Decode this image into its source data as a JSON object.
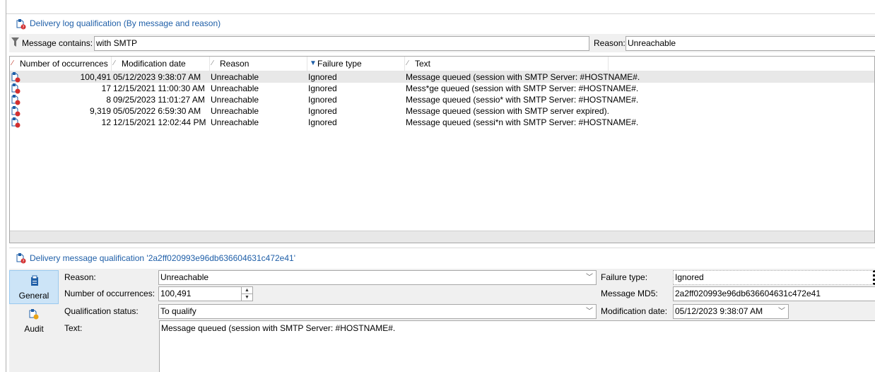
{
  "header": {
    "title": "Delivery log qualification (By message and reason)"
  },
  "filter": {
    "message_label": "Message contains:",
    "message_value": "with SMTP",
    "reason_label": "Reason:",
    "reason_value": "Unreachable"
  },
  "grid": {
    "columns": [
      "Number of occurrences",
      "Modification date",
      "Reason",
      "Failure type",
      "Text"
    ],
    "rows": [
      {
        "count": "100,491",
        "date": "05/12/2023 9:38:07 AM",
        "reason": "Unreachable",
        "failure": "Ignored",
        "text": "Message queued (session with SMTP Server: #HOSTNAME#."
      },
      {
        "count": "17",
        "date": "12/15/2021 11:00:30 AM",
        "reason": "Unreachable",
        "failure": "Ignored",
        "text": "Mess*ge queued (session with SMTP Server: #HOSTNAME#."
      },
      {
        "count": "8",
        "date": "09/25/2023 11:01:27 AM",
        "reason": "Unreachable",
        "failure": "Ignored",
        "text": "Message queued (sessio* with SMTP Server: #HOSTNAME#."
      },
      {
        "count": "9,319",
        "date": "05/05/2022 6:59:30 AM",
        "reason": "Unreachable",
        "failure": "Ignored",
        "text": "Message queued (session with SMTP server expired)."
      },
      {
        "count": "12",
        "date": "12/15/2021 12:02:44 PM",
        "reason": "Unreachable",
        "failure": "Ignored",
        "text": "Message queued (sessi*n with SMTP Server: #HOSTNAME#."
      }
    ]
  },
  "detail": {
    "title": "Delivery message qualification '2a2ff020993e96db636604631c472e41'",
    "tabs": [
      "General",
      "Audit"
    ],
    "reason_label": "Reason:",
    "reason_value": "Unreachable",
    "occurrences_label": "Number of occurrences:",
    "occurrences_value": "100,491",
    "status_label": "Qualification status:",
    "status_value": "To qualify",
    "text_label": "Text:",
    "text_value": "Message queued (session with SMTP Server: #HOSTNAME#.",
    "failure_label": "Failure type:",
    "failure_value": "Ignored",
    "md5_label": "Message MD5:",
    "md5_value": "2a2ff020993e96db636604631c472e41",
    "moddate_label": "Modification date:",
    "moddate_value": "05/12/2023 9:38:07 AM"
  },
  "icons": {
    "title": "delivery-log-icon",
    "filter": "filter-funnel-icon",
    "row": "message-error-icon",
    "general": "clipboard-icon",
    "audit": "audit-icon"
  }
}
